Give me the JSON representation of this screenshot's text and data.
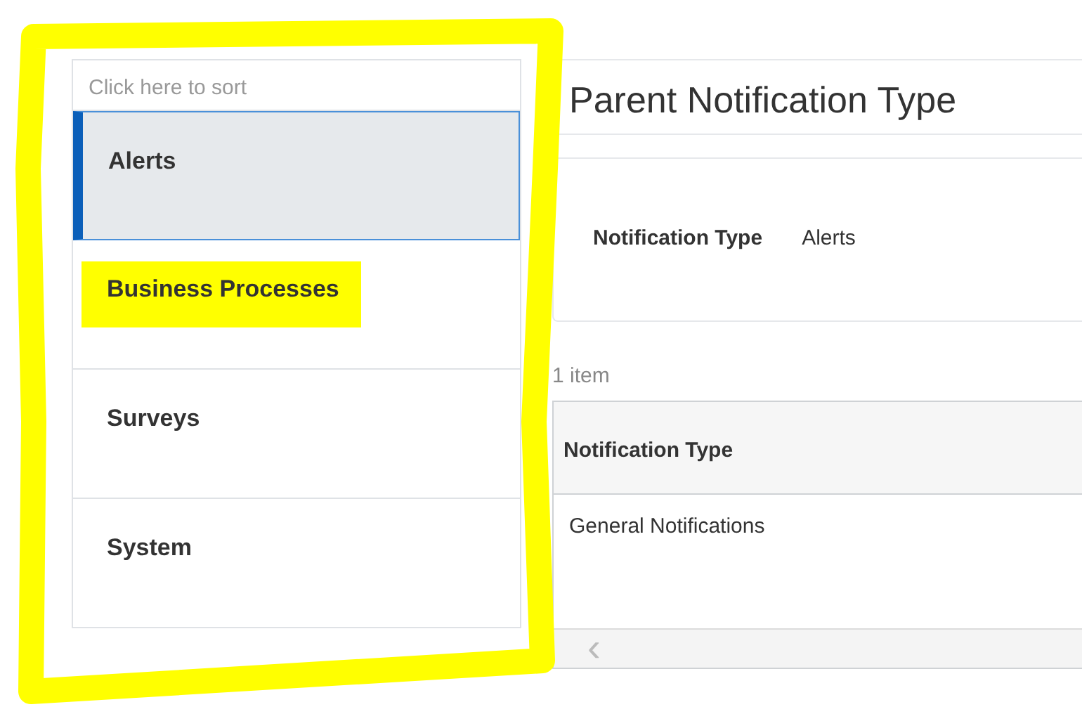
{
  "sort_hint": "Click here to sort",
  "categories": [
    {
      "label": "Alerts",
      "selected": true,
      "highlighted": false
    },
    {
      "label": "Business Processes",
      "selected": false,
      "highlighted": true
    },
    {
      "label": "Surveys",
      "selected": false,
      "highlighted": false
    },
    {
      "label": "System",
      "selected": false,
      "highlighted": false
    }
  ],
  "title": "Parent Notification Type",
  "field": {
    "label": "Notification Type",
    "value": "Alerts"
  },
  "count": "1 item",
  "table": {
    "columns": [
      "Notification Type"
    ],
    "rows": [
      [
        "General Notifications"
      ]
    ],
    "scroll_left": "‹"
  },
  "annotations": [
    {
      "kind": "outline"
    }
  ]
}
